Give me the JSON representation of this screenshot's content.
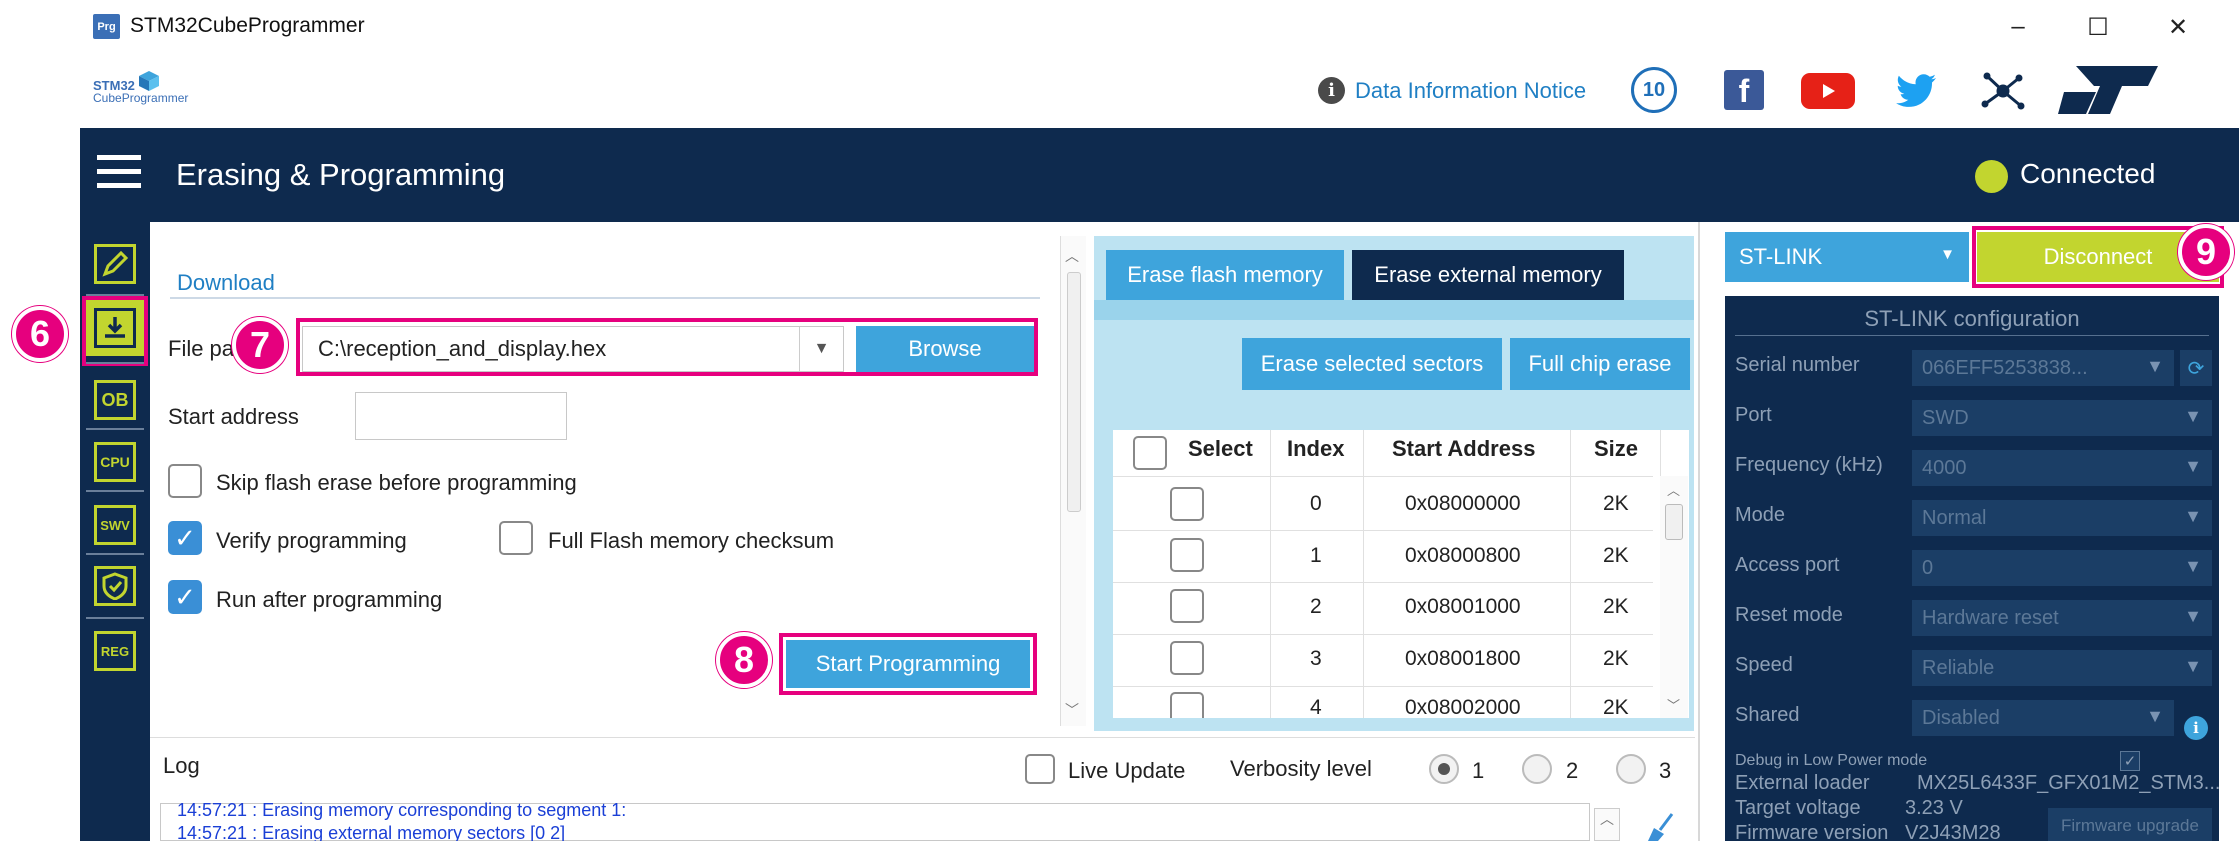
{
  "window": {
    "app_icon_text": "Prg",
    "title": "STM32CubeProgrammer",
    "min": "–",
    "max": "☐",
    "close": "✕"
  },
  "brand": {
    "logo_line1": "STM32",
    "logo_line2": "CubeProgrammer",
    "data_notice": "Data Information Notice",
    "anniversary": "10"
  },
  "header": {
    "title": "Erasing & Programming",
    "status": "Connected",
    "status_color": "#c2d52f"
  },
  "nav": {
    "items": [
      "edit",
      "download",
      "OB",
      "CPU",
      "SWV",
      "security",
      "REG"
    ]
  },
  "download": {
    "section_label": "Download",
    "file_path_label": "File pa",
    "file_path_value": "C:\\reception_and_display.hex",
    "browse_label": "Browse",
    "start_address_label": "Start address",
    "start_address_value": "",
    "skip_flash_erase_label": "Skip flash erase before programming",
    "skip_flash_erase_checked": false,
    "verify_label": "Verify programming",
    "verify_checked": true,
    "full_checksum_label": "Full Flash memory checksum",
    "full_checksum_checked": false,
    "run_after_label": "Run after programming",
    "run_after_checked": true,
    "start_programming_label": "Start Programming"
  },
  "erase": {
    "tab_flash": "Erase flash memory",
    "tab_external": "Erase external memory",
    "erase_selected_label": "Erase selected sectors",
    "full_chip_erase_label": "Full chip erase",
    "columns": [
      "Select",
      "Index",
      "Start Address",
      "Size"
    ],
    "rows": [
      {
        "index": "0",
        "address": "0x08000000",
        "size": "2K"
      },
      {
        "index": "1",
        "address": "0x08000800",
        "size": "2K"
      },
      {
        "index": "2",
        "address": "0x08001000",
        "size": "2K"
      },
      {
        "index": "3",
        "address": "0x08001800",
        "size": "2K"
      },
      {
        "index": "4",
        "address": "0x08002000",
        "size": "2K"
      }
    ]
  },
  "right": {
    "probe_select": "ST-LINK",
    "disconnect_label": "Disconnect",
    "config_title": "ST-LINK configuration",
    "fields": [
      {
        "label": "Serial number",
        "value": "066EFF5253838..."
      },
      {
        "label": "Port",
        "value": "SWD"
      },
      {
        "label": "Frequency (kHz)",
        "value": "4000"
      },
      {
        "label": "Mode",
        "value": "Normal"
      },
      {
        "label": "Access port",
        "value": "0"
      },
      {
        "label": "Reset mode",
        "value": "Hardware reset"
      },
      {
        "label": "Speed",
        "value": "Reliable"
      },
      {
        "label": "Shared",
        "value": "Disabled"
      }
    ],
    "debug_low_power_label": "Debug in Low Power mode",
    "external_loader_label": "External loader",
    "external_loader_value": "MX25L6433F_GFX01M2_STM3...",
    "target_voltage_label": "Target voltage",
    "target_voltage_value": "3.23 V",
    "firmware_version_label": "Firmware version",
    "firmware_version_value": "V2J43M28",
    "firmware_upgrade_label": "Firmware upgrade"
  },
  "log": {
    "title": "Log",
    "live_update_label": "Live Update",
    "verbosity_label": "Verbosity level",
    "levels": [
      "1",
      "2",
      "3"
    ],
    "selected_level": "1",
    "lines": [
      "14:57:21 : Erasing memory corresponding to segment 1:",
      "14:57:21 : Erasing external memory sectors [0 2]"
    ]
  },
  "callouts": {
    "c6": "6",
    "c7": "7",
    "c8": "8",
    "c9": "9"
  },
  "colors": {
    "navy": "#0e2a4e",
    "accent_blue": "#3ea4dc",
    "lime": "#c2d52f",
    "magenta": "#e6007e"
  }
}
